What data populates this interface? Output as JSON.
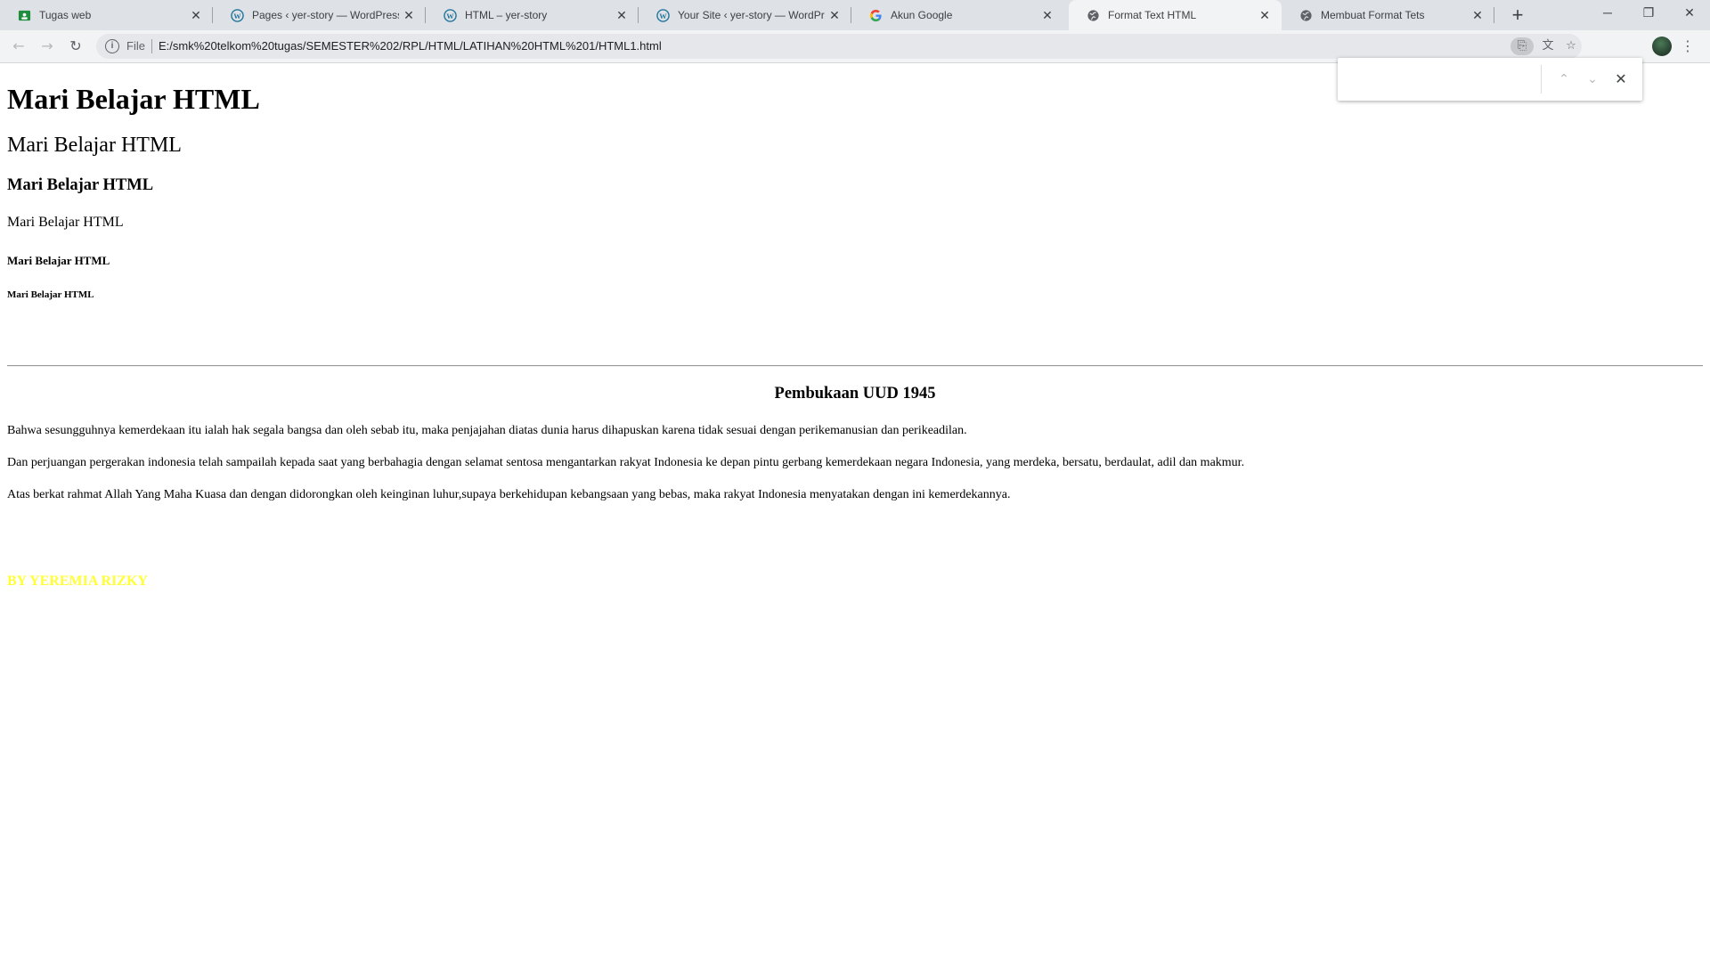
{
  "tabs": [
    {
      "title": "Tugas web",
      "favicon": "classroom-icon",
      "favicon_color": "#1e8e3e",
      "active": false
    },
    {
      "title": "Pages ‹ yer-story — WordPress.c",
      "favicon": "wordpress-icon",
      "active": false
    },
    {
      "title": "HTML – yer-story",
      "favicon": "wordpress-icon",
      "active": false
    },
    {
      "title": "Your Site ‹ yer-story — WordPres",
      "favicon": "wordpress-icon",
      "active": false
    },
    {
      "title": "Akun Google",
      "favicon": "google-icon",
      "active": false
    },
    {
      "title": "Format Text HTML",
      "favicon": "globe-icon",
      "active": true
    },
    {
      "title": "Membuat Format Tets",
      "favicon": "globe-icon",
      "active": false
    }
  ],
  "address_bar": {
    "scheme_label": "File",
    "url": "E:/smk%20telkom%20tugas/SEMESTER%202/RPL/HTML/LATIHAN%20HTML%201/HTML1.html"
  },
  "find_bar": {
    "query": "",
    "count": ""
  },
  "content": {
    "h1": "Mari Belajar HTML",
    "h2": "Mari Belajar HTML",
    "h3": "Mari Belajar HTML",
    "h4": "Mari Belajar HTML",
    "h5": "Mari Belajar HTML",
    "h6": "Mari Belajar HTML",
    "section_title": "Pembukaan UUD 1945",
    "paragraphs": [
      "Bahwa sesungguhnya kemerdekaan itu ialah hak segala bangsa dan oleh sebab itu, maka penjajahan diatas dunia harus dihapuskan karena tidak sesuai dengan perikemanusian dan perikeadilan.",
      "Dan perjuangan pergerakan indonesia telah sampailah kepada saat yang berbahagia dengan selamat sentosa mengantarkan rakyat Indonesia ke depan pintu gerbang kemerdekaan negara Indonesia, yang merdeka, bersatu, berdaulat, adil dan makmur.",
      "Atas berkat rahmat Allah Yang Maha Kuasa dan dengan didorongkan oleh keinginan luhur,supaya berkehidupan kebangsaan yang bebas, maka rakyat Indonesia menyatakan dengan ini kemerdekannya."
    ],
    "credit": "BY YEREMIA RIZKY",
    "credit_color": "#ffff33"
  },
  "colors": {
    "tabstrip": "#dee1e6",
    "toolbar": "#f1f3f4",
    "wordpress": "#21759b",
    "google_blue": "#4285f4"
  }
}
